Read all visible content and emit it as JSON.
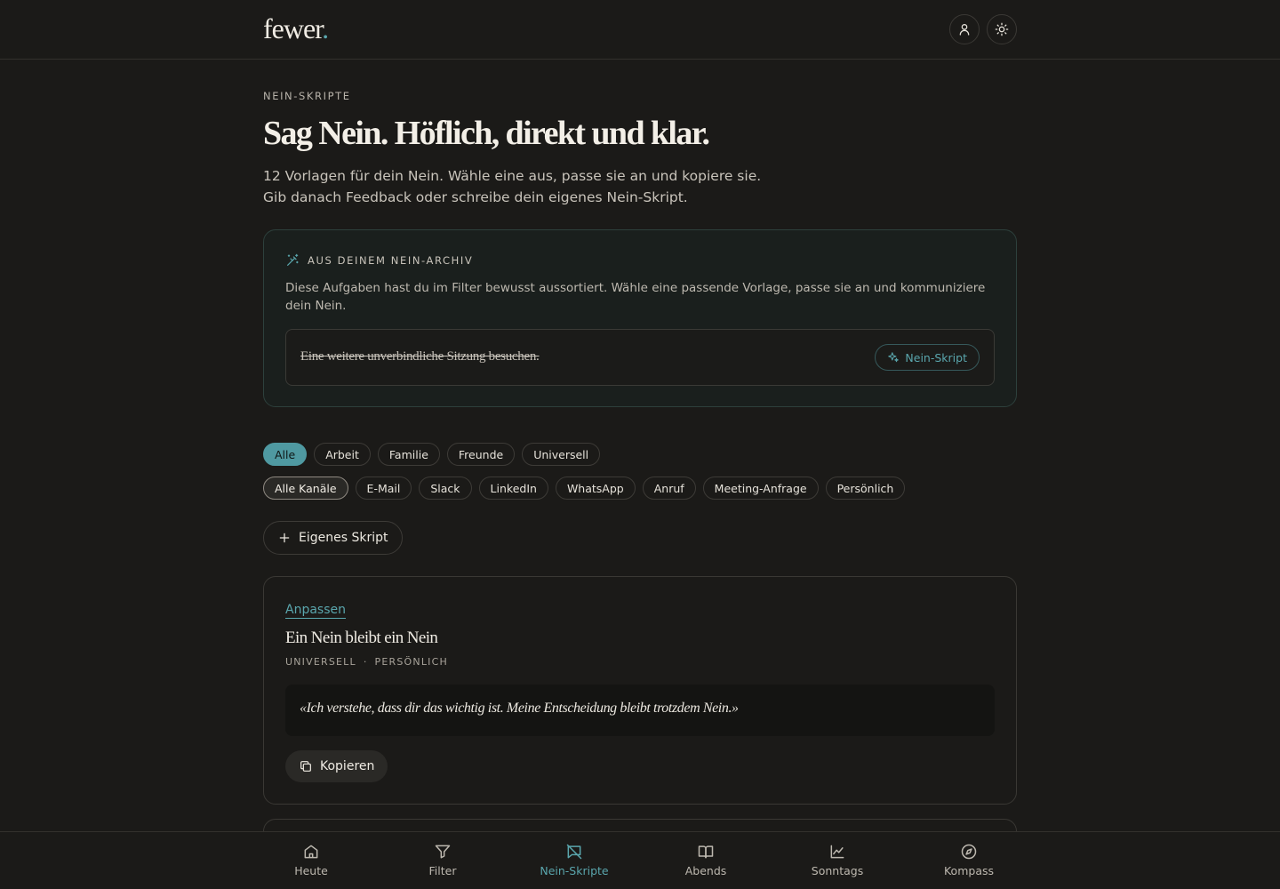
{
  "app": {
    "logo_text": "fewer",
    "logo_dot": "."
  },
  "header": {
    "profile_icon": "user-icon",
    "theme_icon": "sun-icon"
  },
  "intro": {
    "eyebrow": "NEIN-SKRIPTE",
    "title": "Sag Nein. Höflich, direkt und klar.",
    "description": "12 Vorlagen für dein Nein. Wähle eine aus, passe sie an und kopiere sie. Gib danach Feedback oder schreibe dein eigenes Nein-Skript."
  },
  "archive": {
    "icon": "magic-wand-icon",
    "title": "AUS DEINEM NEIN-ARCHIV",
    "description": "Diese Aufgaben hast du im Filter bewusst aussortiert. Wähle eine passende Vorlage, passe sie an und kommuniziere dein Nein.",
    "item_text": "Eine weitere unverbindliche Sitzung besuchen.",
    "item_button": "Nein-Skript"
  },
  "filters": {
    "categories": [
      "Alle",
      "Arbeit",
      "Familie",
      "Freunde",
      "Universell"
    ],
    "channels": [
      "Alle Kanäle",
      "E-Mail",
      "Slack",
      "LinkedIn",
      "WhatsApp",
      "Anruf",
      "Meeting-Anfrage",
      "Persönlich"
    ],
    "selected_category": "Alle",
    "selected_channel": "Alle Kanäle"
  },
  "own_script_button": "Eigenes Skript",
  "card": {
    "link": "Anpassen",
    "title": "Ein Nein bleibt ein Nein",
    "meta_1": "UNIVERSELL",
    "meta_sep": "·",
    "meta_2": "PERSÖNLICH",
    "quote": "«Ich verstehe, dass dir das wichtig ist. Meine Entscheidung bleibt trotzdem Nein.»",
    "copy_button": "Kopieren"
  },
  "bottom_nav": {
    "items": [
      {
        "label": "Heute",
        "icon": "home-icon"
      },
      {
        "label": "Filter",
        "icon": "filter-icon"
      },
      {
        "label": "Nein-Skripte",
        "icon": "message-off-icon"
      },
      {
        "label": "Abends",
        "icon": "book-icon"
      },
      {
        "label": "Sonntags",
        "icon": "chart-icon"
      },
      {
        "label": "Kompass",
        "icon": "compass-icon"
      }
    ],
    "active": "Nein-Skripte"
  },
  "colors": {
    "accent": "#5aa6ad",
    "background": "#1b1a18",
    "active_chip": "#4f99a1"
  }
}
